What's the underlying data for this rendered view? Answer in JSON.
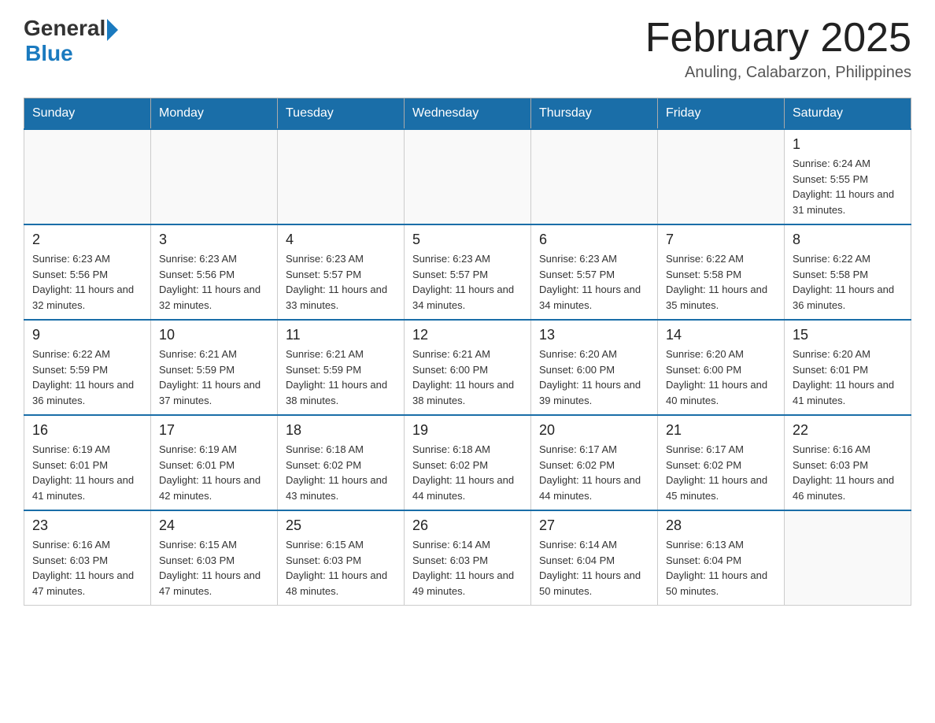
{
  "header": {
    "logo_general": "General",
    "logo_blue": "Blue",
    "title": "February 2025",
    "subtitle": "Anuling, Calabarzon, Philippines"
  },
  "days_of_week": [
    "Sunday",
    "Monday",
    "Tuesday",
    "Wednesday",
    "Thursday",
    "Friday",
    "Saturday"
  ],
  "weeks": [
    [
      {
        "day": "",
        "info": ""
      },
      {
        "day": "",
        "info": ""
      },
      {
        "day": "",
        "info": ""
      },
      {
        "day": "",
        "info": ""
      },
      {
        "day": "",
        "info": ""
      },
      {
        "day": "",
        "info": ""
      },
      {
        "day": "1",
        "info": "Sunrise: 6:24 AM\nSunset: 5:55 PM\nDaylight: 11 hours and 31 minutes."
      }
    ],
    [
      {
        "day": "2",
        "info": "Sunrise: 6:23 AM\nSunset: 5:56 PM\nDaylight: 11 hours and 32 minutes."
      },
      {
        "day": "3",
        "info": "Sunrise: 6:23 AM\nSunset: 5:56 PM\nDaylight: 11 hours and 32 minutes."
      },
      {
        "day": "4",
        "info": "Sunrise: 6:23 AM\nSunset: 5:57 PM\nDaylight: 11 hours and 33 minutes."
      },
      {
        "day": "5",
        "info": "Sunrise: 6:23 AM\nSunset: 5:57 PM\nDaylight: 11 hours and 34 minutes."
      },
      {
        "day": "6",
        "info": "Sunrise: 6:23 AM\nSunset: 5:57 PM\nDaylight: 11 hours and 34 minutes."
      },
      {
        "day": "7",
        "info": "Sunrise: 6:22 AM\nSunset: 5:58 PM\nDaylight: 11 hours and 35 minutes."
      },
      {
        "day": "8",
        "info": "Sunrise: 6:22 AM\nSunset: 5:58 PM\nDaylight: 11 hours and 36 minutes."
      }
    ],
    [
      {
        "day": "9",
        "info": "Sunrise: 6:22 AM\nSunset: 5:59 PM\nDaylight: 11 hours and 36 minutes."
      },
      {
        "day": "10",
        "info": "Sunrise: 6:21 AM\nSunset: 5:59 PM\nDaylight: 11 hours and 37 minutes."
      },
      {
        "day": "11",
        "info": "Sunrise: 6:21 AM\nSunset: 5:59 PM\nDaylight: 11 hours and 38 minutes."
      },
      {
        "day": "12",
        "info": "Sunrise: 6:21 AM\nSunset: 6:00 PM\nDaylight: 11 hours and 38 minutes."
      },
      {
        "day": "13",
        "info": "Sunrise: 6:20 AM\nSunset: 6:00 PM\nDaylight: 11 hours and 39 minutes."
      },
      {
        "day": "14",
        "info": "Sunrise: 6:20 AM\nSunset: 6:00 PM\nDaylight: 11 hours and 40 minutes."
      },
      {
        "day": "15",
        "info": "Sunrise: 6:20 AM\nSunset: 6:01 PM\nDaylight: 11 hours and 41 minutes."
      }
    ],
    [
      {
        "day": "16",
        "info": "Sunrise: 6:19 AM\nSunset: 6:01 PM\nDaylight: 11 hours and 41 minutes."
      },
      {
        "day": "17",
        "info": "Sunrise: 6:19 AM\nSunset: 6:01 PM\nDaylight: 11 hours and 42 minutes."
      },
      {
        "day": "18",
        "info": "Sunrise: 6:18 AM\nSunset: 6:02 PM\nDaylight: 11 hours and 43 minutes."
      },
      {
        "day": "19",
        "info": "Sunrise: 6:18 AM\nSunset: 6:02 PM\nDaylight: 11 hours and 44 minutes."
      },
      {
        "day": "20",
        "info": "Sunrise: 6:17 AM\nSunset: 6:02 PM\nDaylight: 11 hours and 44 minutes."
      },
      {
        "day": "21",
        "info": "Sunrise: 6:17 AM\nSunset: 6:02 PM\nDaylight: 11 hours and 45 minutes."
      },
      {
        "day": "22",
        "info": "Sunrise: 6:16 AM\nSunset: 6:03 PM\nDaylight: 11 hours and 46 minutes."
      }
    ],
    [
      {
        "day": "23",
        "info": "Sunrise: 6:16 AM\nSunset: 6:03 PM\nDaylight: 11 hours and 47 minutes."
      },
      {
        "day": "24",
        "info": "Sunrise: 6:15 AM\nSunset: 6:03 PM\nDaylight: 11 hours and 47 minutes."
      },
      {
        "day": "25",
        "info": "Sunrise: 6:15 AM\nSunset: 6:03 PM\nDaylight: 11 hours and 48 minutes."
      },
      {
        "day": "26",
        "info": "Sunrise: 6:14 AM\nSunset: 6:03 PM\nDaylight: 11 hours and 49 minutes."
      },
      {
        "day": "27",
        "info": "Sunrise: 6:14 AM\nSunset: 6:04 PM\nDaylight: 11 hours and 50 minutes."
      },
      {
        "day": "28",
        "info": "Sunrise: 6:13 AM\nSunset: 6:04 PM\nDaylight: 11 hours and 50 minutes."
      },
      {
        "day": "",
        "info": ""
      }
    ]
  ]
}
